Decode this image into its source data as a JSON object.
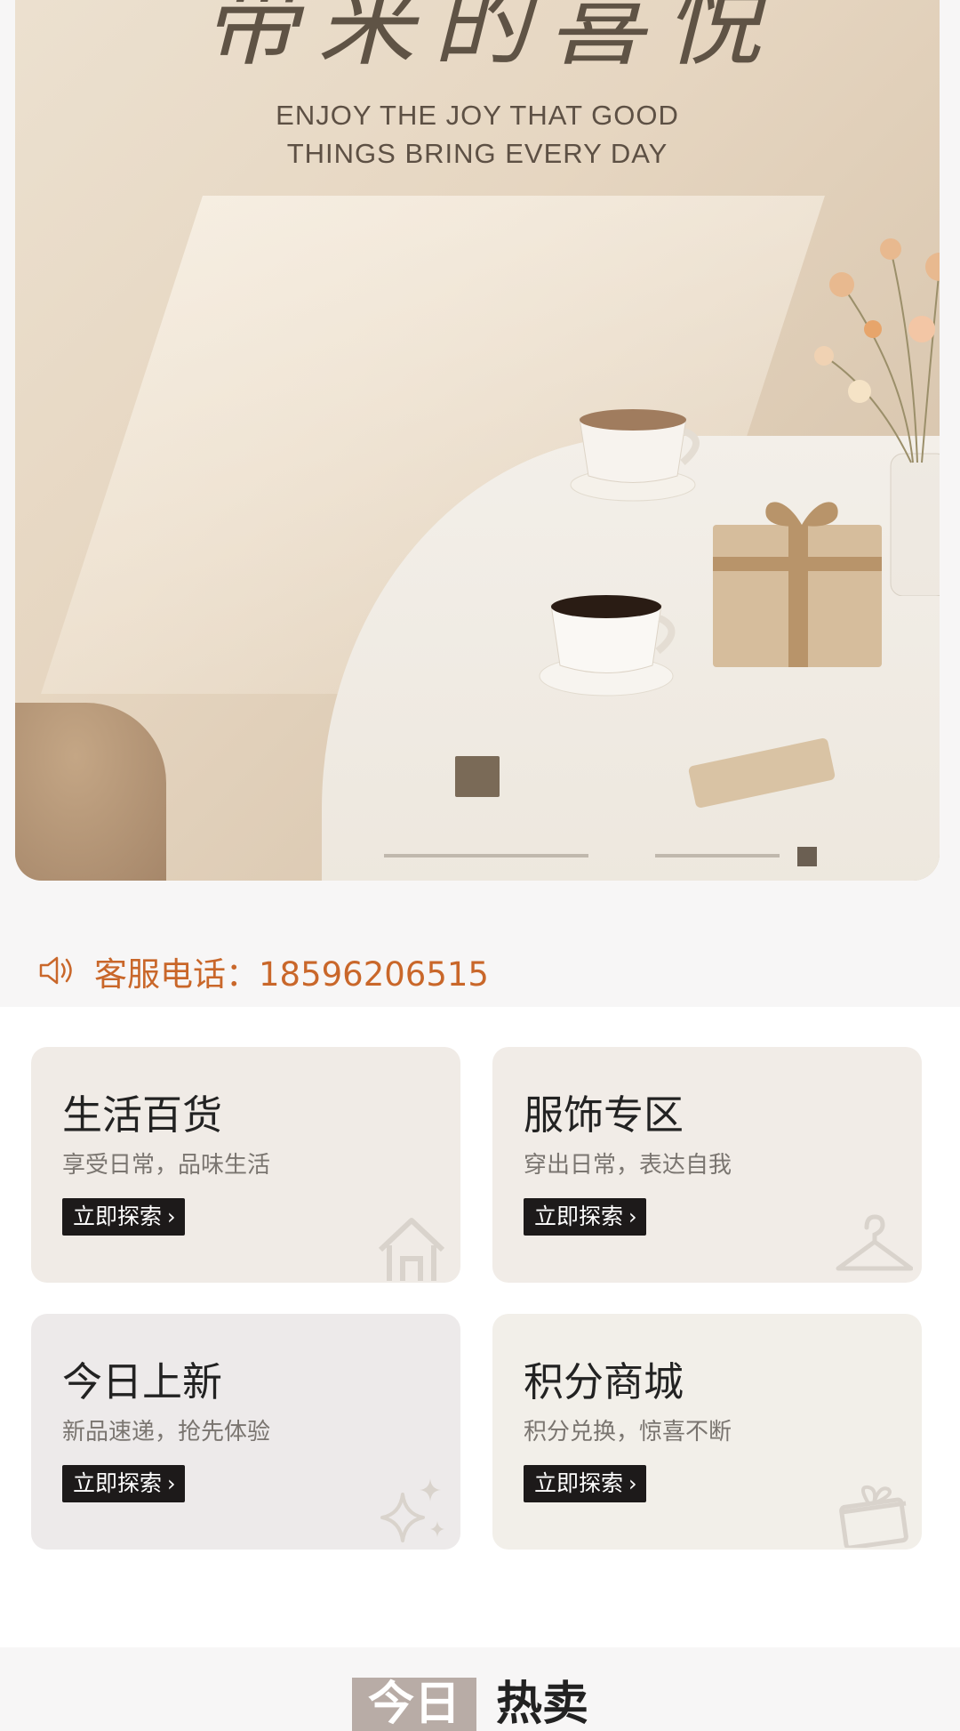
{
  "banner": {
    "headline": "带来的喜悦",
    "tagline_line1": "ENJOY THE JOY THAT GOOD",
    "tagline_line2": "THINGS BRING EVERY DAY"
  },
  "notice": {
    "icon": "speaker-icon",
    "text": "客服电话：18596206515",
    "color": "#c9672a"
  },
  "categories": [
    {
      "title": "生活百货",
      "subtitle": "享受日常，品味生活",
      "button": "立即探索",
      "icon": "house-icon"
    },
    {
      "title": "服饰专区",
      "subtitle": "穿出日常，表达自我",
      "button": "立即探索",
      "icon": "hanger-icon"
    },
    {
      "title": "今日上新",
      "subtitle": "新品速递，抢先体验",
      "button": "立即探索",
      "icon": "sparkle-icon"
    },
    {
      "title": "积分商城",
      "subtitle": "积分兑换，惊喜不断",
      "button": "立即探索",
      "icon": "gift-icon"
    }
  ],
  "hot_section": {
    "title_highlight": "今日",
    "title_rest": "热卖"
  }
}
